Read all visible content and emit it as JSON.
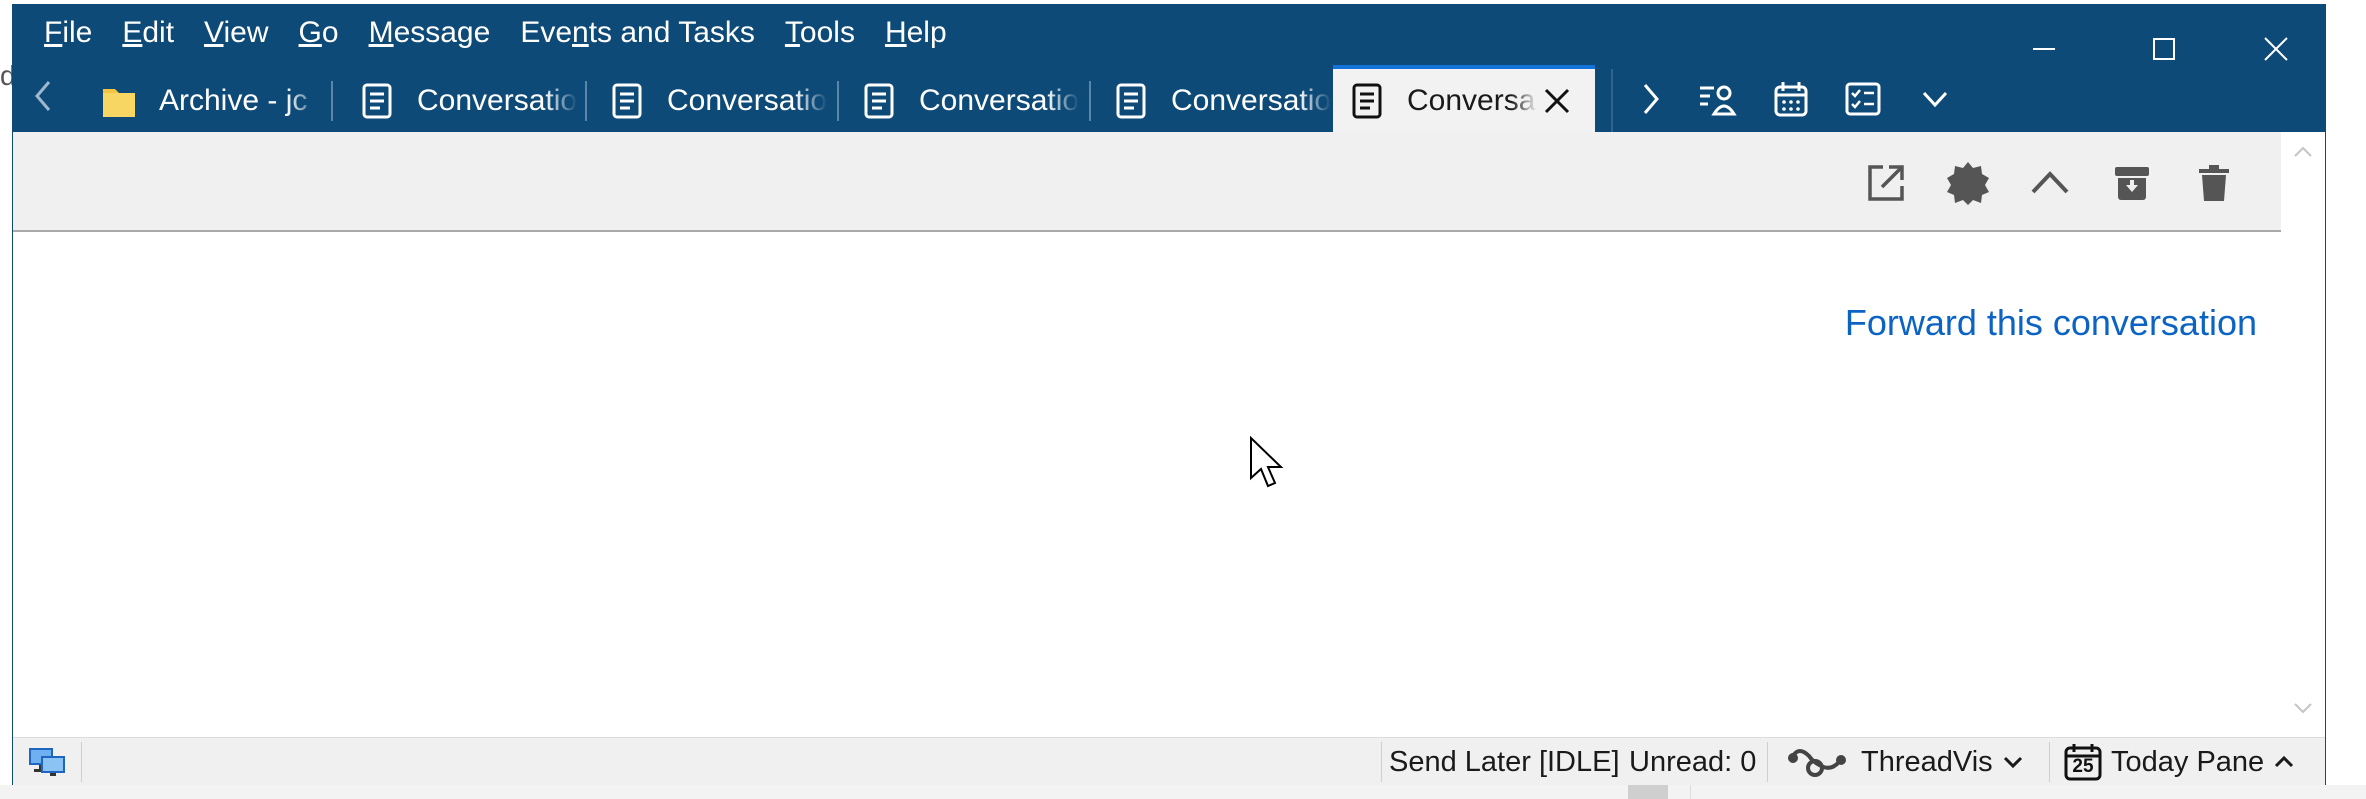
{
  "background": {
    "left_fragment_text": "d"
  },
  "menu": {
    "items": [
      {
        "label": "File",
        "accel": "F",
        "rest": "ile"
      },
      {
        "label": "Edit",
        "accel": "E",
        "rest": "dit"
      },
      {
        "label": "View",
        "accel": "V",
        "rest": "iew"
      },
      {
        "label": "Go",
        "accel": "G",
        "rest": "o"
      },
      {
        "label": "Message",
        "accel": "M",
        "rest": "essage"
      },
      {
        "label": "Events and Tasks",
        "pre": "Eve",
        "accel": "n",
        "rest": "ts and Tasks"
      },
      {
        "label": "Tools",
        "accel": "T",
        "rest": "ools"
      },
      {
        "label": "Help",
        "accel": "H",
        "rest": "elp"
      }
    ]
  },
  "tabs": [
    {
      "label": "Archive - jc",
      "icon": "folder-icon",
      "selected": false
    },
    {
      "label": "Conversation",
      "icon": "message-icon",
      "selected": false
    },
    {
      "label": "Conversation",
      "icon": "message-icon",
      "selected": false
    },
    {
      "label": "Conversation",
      "icon": "message-icon",
      "selected": false
    },
    {
      "label": "Conversation",
      "icon": "message-icon",
      "selected": false
    },
    {
      "label": "Conversation",
      "icon": "message-icon",
      "selected": true
    }
  ],
  "content": {
    "forward_link": "Forward this conversation"
  },
  "status_bar": {
    "send_later": "Send Later [IDLE]",
    "unread": "Unread: 0",
    "threadvis": "ThreadVis",
    "today_pane": "Today Pane",
    "today_date": "25"
  },
  "colors": {
    "titlebar": "#0e4a77",
    "selected_tab_accent": "#1373d9",
    "link": "#0b63c4",
    "toolbar_bg": "#f0f0f0"
  }
}
